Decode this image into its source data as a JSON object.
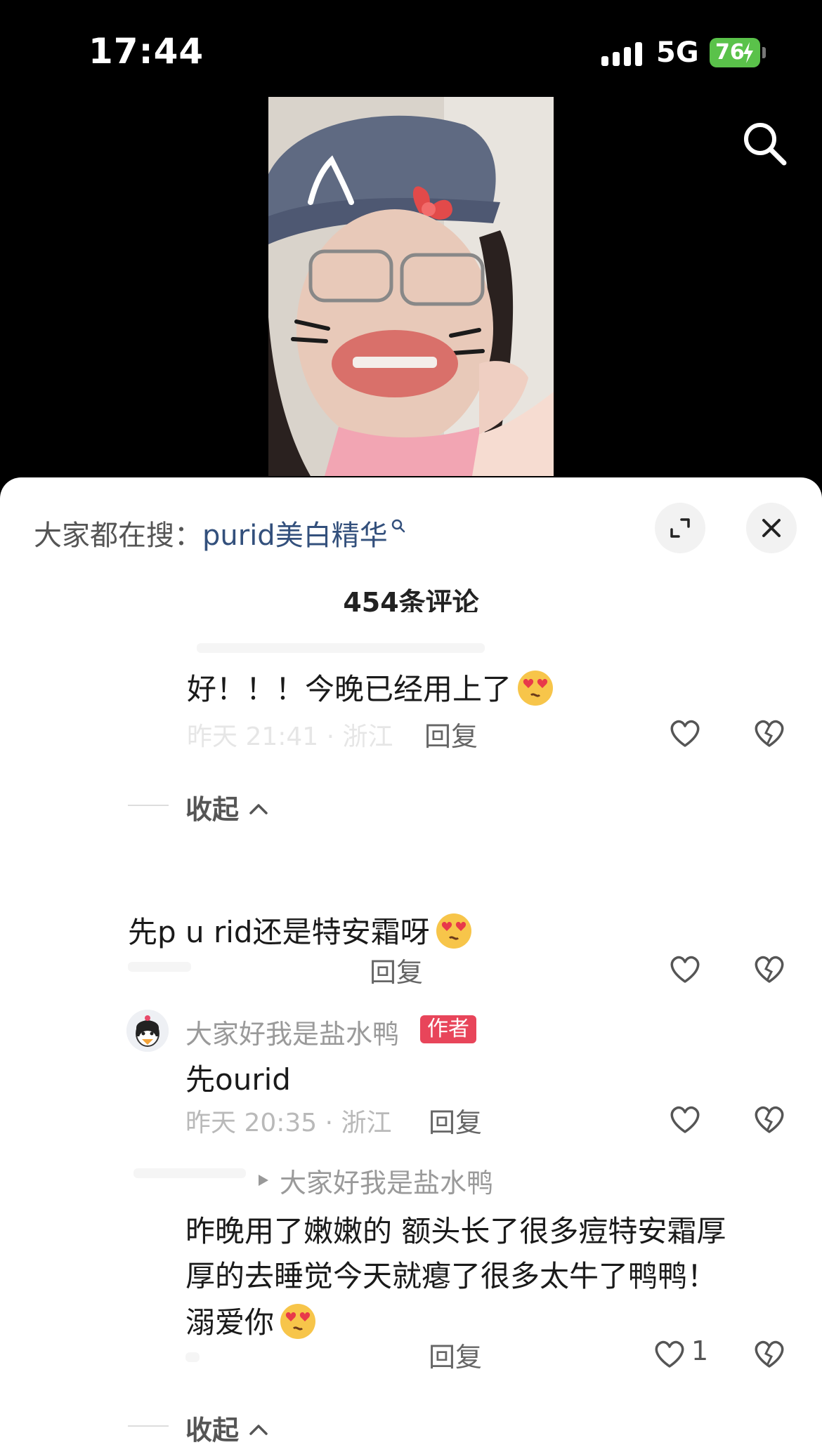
{
  "status_bar": {
    "time": "17:44",
    "network": "5G",
    "battery": "76"
  },
  "panel": {
    "hot_search_prefix": "大家都在搜：",
    "hot_search_keyword": "purid美白精华",
    "comment_count": "454条评论"
  },
  "comments": [
    {
      "text": "好！！！今晚已经用上了",
      "meta": "昨天 21:41 · 浙江",
      "reply": "回复"
    },
    {
      "collapse": "收起"
    },
    {
      "text": "先p u rid还是特安霜呀",
      "reply": "回复"
    },
    {
      "author": "大家好我是盐水鸭",
      "badge": "作者",
      "text": "先ourid",
      "meta": "昨天 20:35 · 浙江",
      "reply": "回复"
    },
    {
      "reply_to": "大家好我是盐水鸭",
      "text_line1": "昨晚用了嫩嫩的 额头长了很多痘特安霜厚",
      "text_line2": "厚的去睡觉今天就瘪了很多太牛了鸭鸭！",
      "text_line3": "溺爱你",
      "reply": "回复",
      "likes": "1"
    },
    {
      "collapse": "收起"
    }
  ]
}
